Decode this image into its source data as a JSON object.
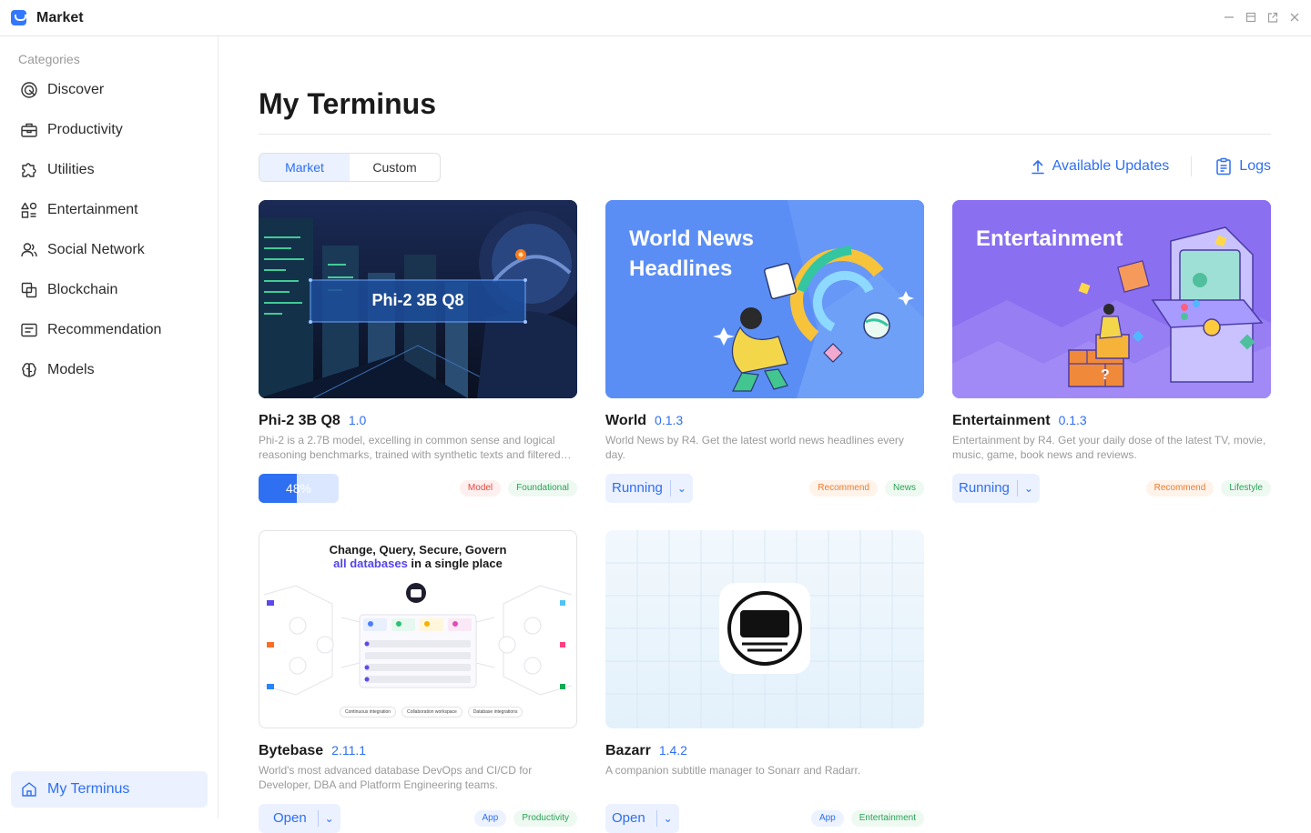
{
  "window": {
    "title": "Market",
    "controls": [
      "minimize-icon",
      "restore-icon",
      "popout-icon",
      "close-icon"
    ]
  },
  "sidebar": {
    "heading": "Categories",
    "items": [
      {
        "label": "Discover",
        "icon": "discover-icon"
      },
      {
        "label": "Productivity",
        "icon": "briefcase-icon"
      },
      {
        "label": "Utilities",
        "icon": "puzzle-icon"
      },
      {
        "label": "Entertainment",
        "icon": "shapes-icon"
      },
      {
        "label": "Social Network",
        "icon": "people-icon"
      },
      {
        "label": "Blockchain",
        "icon": "blockchain-icon"
      },
      {
        "label": "Recommendation",
        "icon": "recommendation-icon"
      },
      {
        "label": "Models",
        "icon": "brain-icon"
      }
    ],
    "bottom": {
      "label": "My Terminus",
      "icon": "home-icon"
    }
  },
  "main": {
    "title": "My Terminus",
    "tabs": [
      {
        "label": "Market",
        "active": true
      },
      {
        "label": "Custom",
        "active": false
      }
    ],
    "actions": {
      "updates": "Available Updates",
      "logs": "Logs"
    },
    "accent": "#2f6ff2"
  },
  "apps": [
    {
      "name": "Phi-2 3B Q8",
      "version": "1.0",
      "description": "Phi-2 is a 2.7B model, excelling in common sense and logical reasoning benchmarks, trained with synthetic texts and filtered websites.",
      "thumb_label": "Phi-2 3B Q8",
      "progress_text": "48%",
      "progress": 0.48,
      "tags": [
        {
          "label": "Model",
          "tone": "red"
        },
        {
          "label": "Foundational",
          "tone": "green"
        }
      ]
    },
    {
      "name": "World",
      "version": "0.1.3",
      "description": "World News by R4. Get the latest world news headlines every day.",
      "thumb_title_1": "World News",
      "thumb_title_2": "Headlines",
      "status": "Running",
      "tags": [
        {
          "label": "Recommend",
          "tone": "orange"
        },
        {
          "label": "News",
          "tone": "green"
        }
      ]
    },
    {
      "name": "Entertainment",
      "version": "0.1.3",
      "description": "Entertainment by R4. Get your daily dose of the latest TV, movie, music, game, book news and reviews.",
      "thumb_title": "Entertainment",
      "status": "Running",
      "tags": [
        {
          "label": "Recommend",
          "tone": "orange"
        },
        {
          "label": "Lifestyle",
          "tone": "green"
        }
      ]
    },
    {
      "name": "Bytebase",
      "version": "2.11.1",
      "description": "World's most advanced database DevOps and CI/CD for Developer, DBA and Platform Engineering teams.",
      "thumb_line_1": "Change, Query, Secure, Govern",
      "thumb_line_2a": "all databases",
      "thumb_line_2b": " in a single place",
      "thumb_chips": [
        "Continuous integration",
        "Collaboration workspace",
        "Database integrations"
      ],
      "status": "Open",
      "tags": [
        {
          "label": "App",
          "tone": "blue"
        },
        {
          "label": "Productivity",
          "tone": "green"
        }
      ]
    },
    {
      "name": "Bazarr",
      "version": "1.4.2",
      "description": "A companion subtitle manager to Sonarr and Radarr.",
      "status": "Open",
      "tags": [
        {
          "label": "App",
          "tone": "blue"
        },
        {
          "label": "Entertainment",
          "tone": "green"
        }
      ]
    }
  ]
}
